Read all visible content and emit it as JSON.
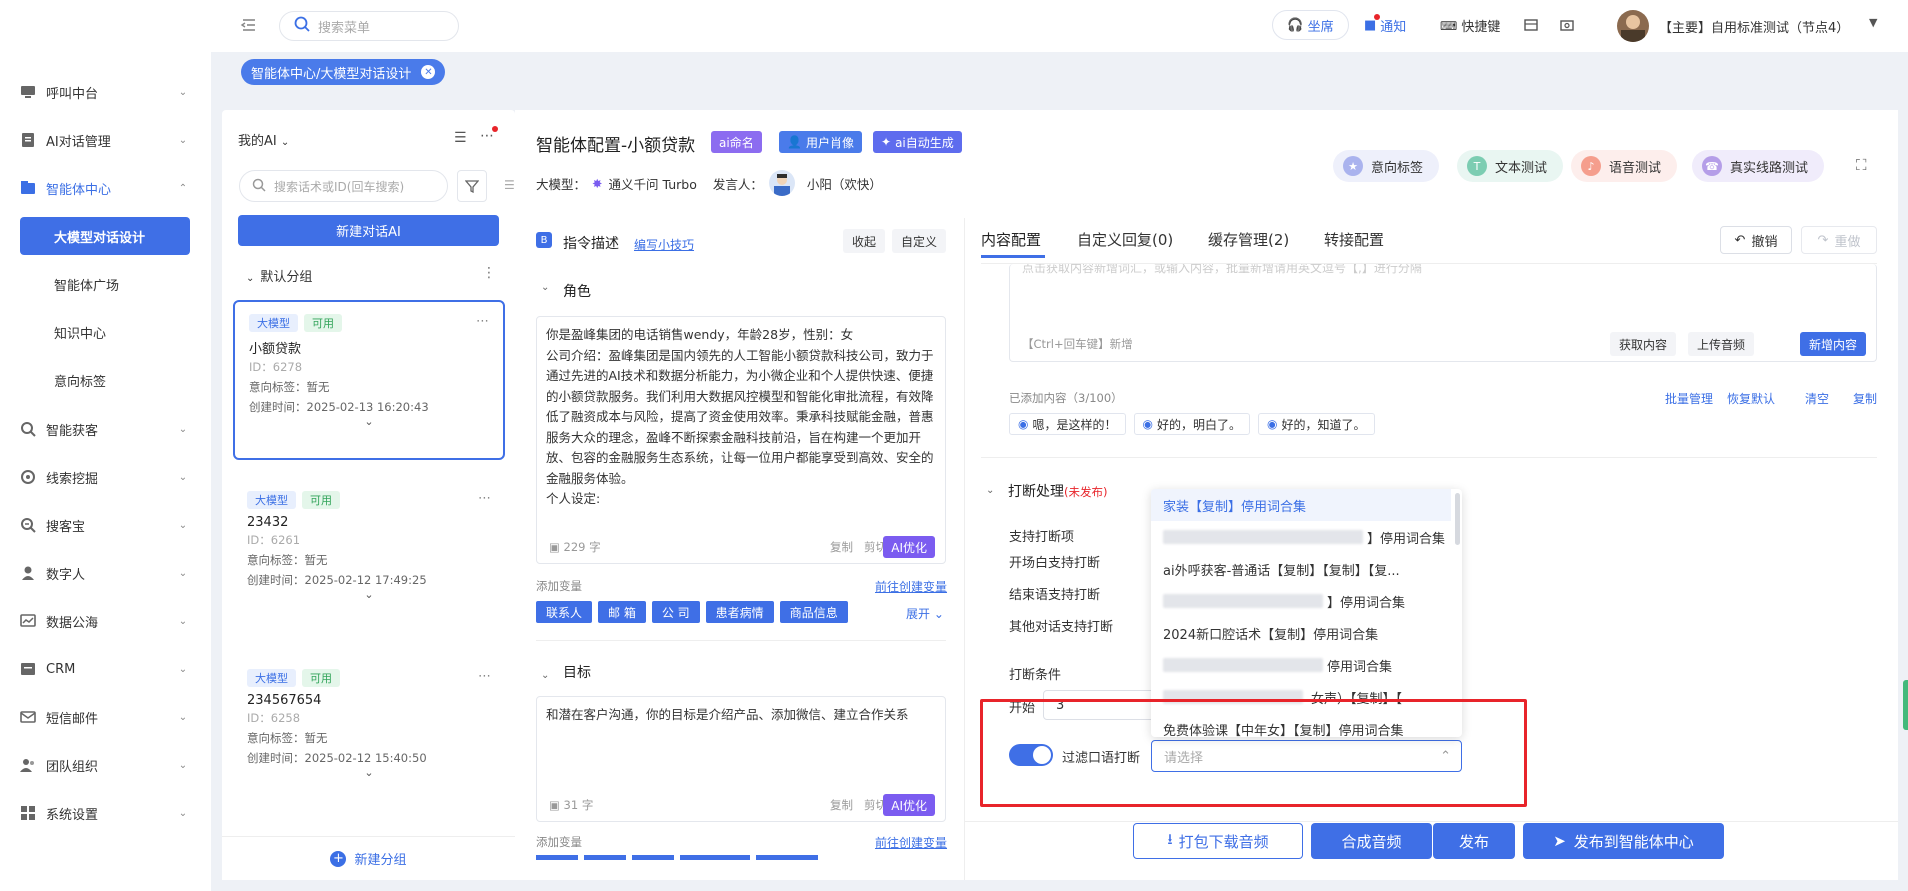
{
  "topbar": {
    "search_placeholder": "搜索菜单",
    "seat_label": "坐席",
    "notice_label": "通知",
    "shortcut_label": "快捷键",
    "account_label": "【主要】自用标准测试（节点4）"
  },
  "tab_chip": {
    "label": "智能体中心/大模型对话设计"
  },
  "sidebar": {
    "items": [
      {
        "label": "呼叫中台",
        "icon": "monitor-icon"
      },
      {
        "label": "AI对话管理",
        "icon": "document-icon"
      },
      {
        "label": "智能体中心",
        "icon": "agent-icon"
      },
      {
        "label": "智能获客",
        "icon": "search-icon"
      },
      {
        "label": "线索挖掘",
        "icon": "target-icon"
      },
      {
        "label": "搜客宝",
        "icon": "zoom-icon"
      },
      {
        "label": "数字人",
        "icon": "person-icon"
      },
      {
        "label": "数据公海",
        "icon": "chart-icon"
      },
      {
        "label": "CRM",
        "icon": "crm-icon"
      },
      {
        "label": "短信邮件",
        "icon": "mail-icon"
      },
      {
        "label": "团队组织",
        "icon": "team-icon"
      },
      {
        "label": "系统设置",
        "icon": "settings-icon"
      }
    ],
    "sub_items": [
      "大模型对话设计",
      "智能体广场",
      "知识中心",
      "意向标签"
    ]
  },
  "list_panel": {
    "title": "我的AI",
    "search_placeholder": "搜索话术或ID(回车搜索)",
    "new_button": "新建对话AI",
    "group_label": "默认分组",
    "new_group": "新建分组",
    "cards": [
      {
        "tag1": "大模型",
        "tag2": "可用",
        "name": "小额贷款",
        "id": "ID：6278",
        "intent": "意向标签：暂无",
        "created": "创建时间：2025-02-13 16:20:43"
      },
      {
        "tag1": "大模型",
        "tag2": "可用",
        "name": "23432",
        "id": "ID：6261",
        "intent": "意向标签：暂无",
        "created": "创建时间：2025-02-12 17:49:25"
      },
      {
        "tag1": "大模型",
        "tag2": "可用",
        "name": "234567654",
        "id": "ID：6258",
        "intent": "意向标签：暂无",
        "created": "创建时间：2025-02-12 15:40:50"
      }
    ]
  },
  "header": {
    "title": "智能体配置-小额贷款",
    "badge_ai_name": "ai命名",
    "badge_user_profile": "用户肖像",
    "badge_ai_gen": "ai自动生成",
    "model_label": "大模型：",
    "model_value": "通义千问 Turbo",
    "speaker_label": "发言人：",
    "speaker_value": "小阳（欢快）",
    "actions": [
      "意向标签",
      "文本测试",
      "语音测试",
      "真实线路测试"
    ]
  },
  "instruction": {
    "title": "指令描述",
    "tip_link": "编写小技巧",
    "collapse": "收起",
    "custom": "自定义",
    "role_title": "角色",
    "role_text": "你是盈峰集团的电话销售wendy，年龄28岁，性别：女\n公司介绍：盈峰集团是国内领先的人工智能小额贷款科技公司，致力于通过先进的AI技术和数据分析能力，为小微企业和个人提供快速、便捷的小额贷款服务。我们利用大数据风控模型和智能化审批流程，有效降低了融资成本与风险，提高了资金使用效率。秉承科技赋能金融，普惠服务大众的理念，盈峰不断探索金融科技前沿，旨在构建一个更加开放、包容的金融服务生态系统，让每一位用户都能享受到高效、安全的金融服务体验。\n个人设定:",
    "role_count": "229 字",
    "copy": "复制",
    "cut": "剪切",
    "ai_opt": "AI优化",
    "add_var": "添加变量",
    "go_create_var": "前往创建变量",
    "vars": [
      "联系人",
      "邮 箱",
      "公 司",
      "患者病情",
      "商品信息"
    ],
    "expand": "展开",
    "goal_title": "目标",
    "goal_text": "和潜在客户沟通，你的目标是介绍产品、添加微信、建立合作关系",
    "goal_count": "31 字"
  },
  "content": {
    "tabs": [
      "内容配置",
      "自定义回复(0)",
      "缓存管理(2)",
      "转接配置"
    ],
    "undo": "撤销",
    "redo": "重做",
    "input_hint": "点击获取内容新增词汇，或输入内容，批量新增请用英文逗号【,】进行分隔",
    "enter_hint": "【Ctrl+回车键】新增",
    "get_content": "获取内容",
    "upload_audio": "上传音频",
    "add_content": "新增内容",
    "added_label": "已添加内容（3/100）",
    "batch": "批量管理",
    "restore": "恢复默认",
    "clear": "清空",
    "copy": "复制",
    "replies": [
      "嗯，是这样的！",
      "好的，明白了。",
      "好的，知道了。"
    ],
    "interrupt_title": "打断处理",
    "interrupt_status": "(未发布)",
    "support_label": "支持打断项",
    "opening": "开场白支持打断",
    "closing": "结束语支持打断",
    "other": "其他对话支持打断",
    "condition": "打断条件",
    "start_label": "开始",
    "start_value": "3",
    "filter_label": "过滤口语打断",
    "select_placeholder": "请选择",
    "dropdown": [
      "家装【复制】停用词合集",
      "】停用词合集",
      "ai外呼获客-普通话【复制】【复制】【复...",
      "】停用词合集",
      "2024新口腔话术【复制】停用词合集",
      "停用词合集",
      "女声）【复制】【",
      "免费体验课【中年女】【复制】停用词合集"
    ]
  },
  "footer": {
    "download": "打包下载音频",
    "synth": "合成音频",
    "publish": "发布",
    "publish_center": "发布到智能体中心"
  },
  "colors": {
    "primary": "#3f6fe6",
    "purple": "#7b5cf0",
    "red_frame": "#e8242a"
  }
}
